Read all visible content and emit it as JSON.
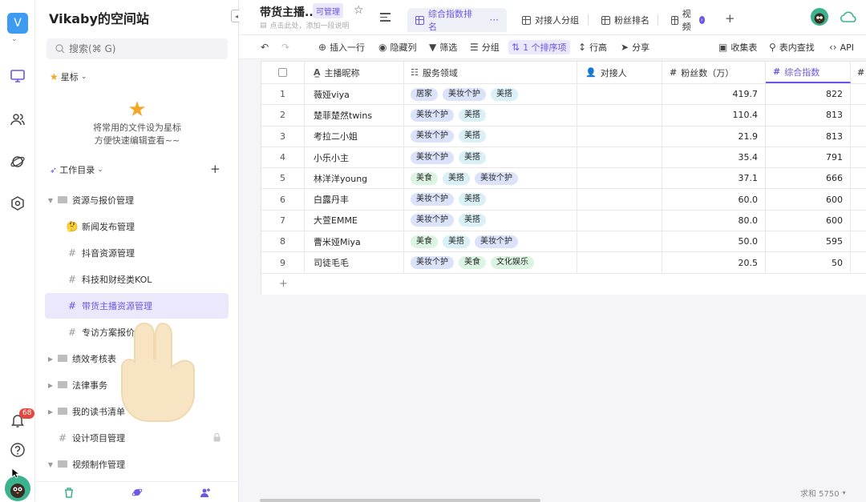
{
  "workspace": {
    "avatar_letter": "V",
    "space_title": "Vikaby的空间站",
    "notification_count": "68"
  },
  "sidebar": {
    "search_placeholder": "搜索(⌘ G)",
    "star_section": "星标",
    "star_hint_line1": "将常用的文件设为星标",
    "star_hint_line2": "方便快速编辑查看~~",
    "work_dir": "工作目录",
    "tree": [
      {
        "label": "资源与报价管理",
        "type": "folder",
        "expanded": true
      },
      {
        "label": "新闻发布管理",
        "type": "emoji-sheet"
      },
      {
        "label": "抖音资源管理",
        "type": "sheet"
      },
      {
        "label": "科技和财经类KOL",
        "type": "sheet"
      },
      {
        "label": "带货主播资源管理",
        "type": "sheet",
        "active": true
      },
      {
        "label": "专访方案报价",
        "type": "sheet"
      },
      {
        "label": "绩效考核表",
        "type": "folder"
      },
      {
        "label": "法律事务",
        "type": "folder"
      },
      {
        "label": "我的读书清单",
        "type": "folder"
      },
      {
        "label": "设计项目管理",
        "type": "sheet",
        "locked": true
      },
      {
        "label": "视频制作管理",
        "type": "folder",
        "expanded": true
      }
    ]
  },
  "header": {
    "sheet_title": "带货主播...",
    "permission": "可管理",
    "description": "点击此处，添加一段说明",
    "views": [
      {
        "label": "综合指数排名",
        "active": true
      },
      {
        "label": "对接人分组"
      },
      {
        "label": "粉丝排名"
      },
      {
        "label": "视频"
      }
    ]
  },
  "toolbar": {
    "insert_row": "插入一行",
    "hide_columns": "隐藏列",
    "filter": "筛选",
    "group": "分组",
    "sort": "1 个排序项",
    "row_height": "行高",
    "share": "分享",
    "form": "收集表",
    "find": "表内查找",
    "api": "API"
  },
  "table": {
    "columns": {
      "name": "主播昵称",
      "service": "服务领域",
      "contact": "对接人",
      "fans": "粉丝数（万）",
      "score": "综合指数"
    },
    "rows": [
      {
        "idx": "1",
        "name": "薇娅viya",
        "tags": [
          "居家",
          "美妆个护",
          "美搭"
        ],
        "fans": "419.7",
        "score": "822"
      },
      {
        "idx": "2",
        "name": "楚菲楚然twins",
        "tags": [
          "美妆个护",
          "美搭"
        ],
        "fans": "110.4",
        "score": "813"
      },
      {
        "idx": "3",
        "name": "考拉二小姐",
        "tags": [
          "美妆个护",
          "美搭"
        ],
        "fans": "21.9",
        "score": "813"
      },
      {
        "idx": "4",
        "name": "小乐小主",
        "tags": [
          "美妆个护",
          "美搭"
        ],
        "fans": "35.4",
        "score": "791"
      },
      {
        "idx": "5",
        "name": "林洋洋young",
        "tags": [
          "美食",
          "美搭",
          "美妆个护"
        ],
        "fans": "37.1",
        "score": "666"
      },
      {
        "idx": "6",
        "name": "白露丹丰",
        "tags": [
          "美妆个护",
          "美搭"
        ],
        "fans": "60.0",
        "score": "600"
      },
      {
        "idx": "7",
        "name": "大萱EMME",
        "tags": [
          "美妆个护",
          "美搭"
        ],
        "fans": "80.0",
        "score": "600"
      },
      {
        "idx": "8",
        "name": "曹米娅Miya",
        "tags": [
          "美食",
          "美搭",
          "美妆个护"
        ],
        "fans": "50.0",
        "score": "595"
      },
      {
        "idx": "9",
        "name": "司徒毛毛",
        "tags": [
          "美妆个护",
          "美食",
          "文化娱乐"
        ],
        "fans": "20.5",
        "score": "50"
      }
    ],
    "add_row": "+",
    "footer_sum": "求和 5750"
  },
  "tag_colors": {
    "居家": "#dbe3fb",
    "美妆个护": "#dbe3fb",
    "美搭": "#d9f0f6",
    "美食": "#dcf4e2",
    "文化娱乐": "#dcf4e2"
  },
  "colors": {
    "accent": "#6f55e5",
    "active_bg": "#ebe8fb"
  }
}
